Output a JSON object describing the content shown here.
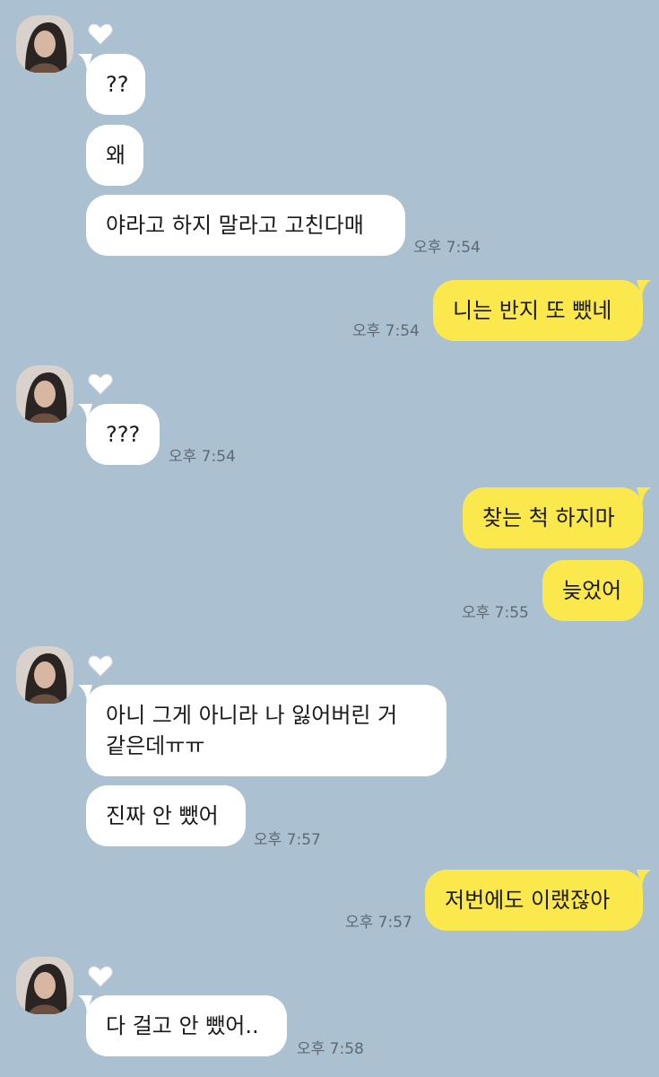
{
  "messages": [
    {
      "text": "??"
    },
    {
      "text": "왜"
    },
    {
      "text": "야라고 하지 말라고 고친다매",
      "time": "오후 7:54"
    },
    {
      "text": "니는 반지 또 뺐네",
      "time": "오후 7:54"
    },
    {
      "text": "???",
      "time": "오후 7:54"
    },
    {
      "text": "찾는 척 하지마"
    },
    {
      "text": "늦었어",
      "time": "오후 7:55"
    },
    {
      "text_line1": "아니 그게 아니라 나 잃어버린 거",
      "text_line2": "같은데ㅠㅠ"
    },
    {
      "text": "진짜 안 뺐어",
      "time": "오후 7:57"
    },
    {
      "text": "저번에도 이랬잖아",
      "time": "오후 7:57"
    },
    {
      "text": "다 걸고 안 뺐어..",
      "time": "오후 7:58"
    }
  ],
  "icons": {
    "avatar": "profile-photo",
    "heart": "heart-icon"
  },
  "colors": {
    "background": "#abc1d1",
    "incoming": "#ffffff",
    "outgoing": "#fae84c"
  }
}
